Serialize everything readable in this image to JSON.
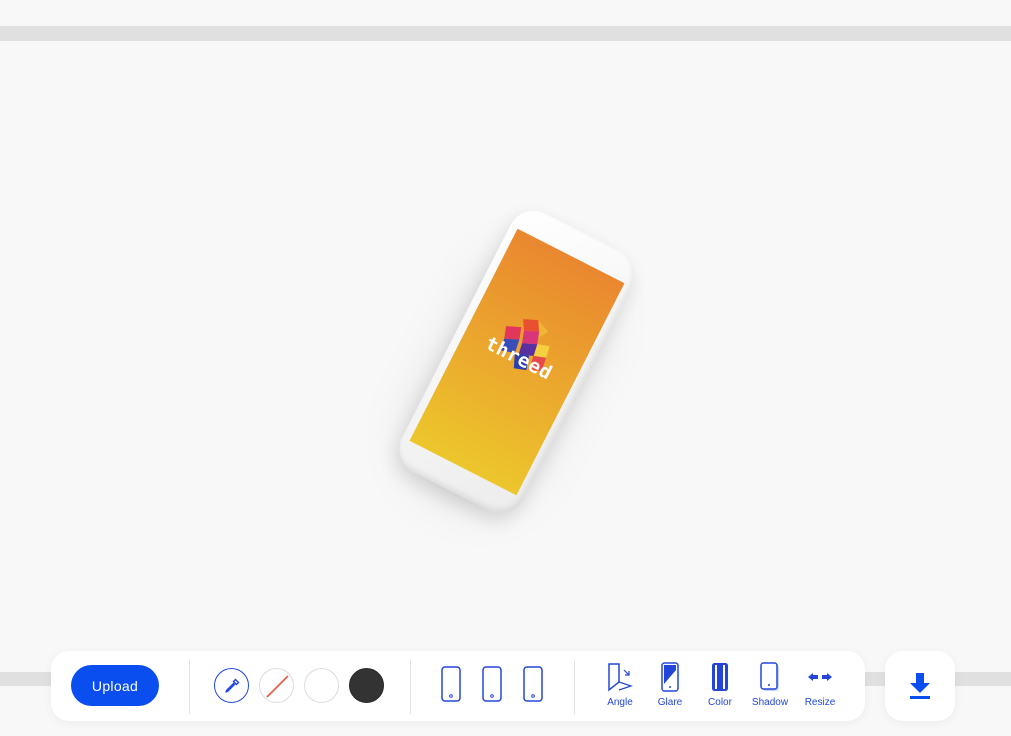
{
  "toolbar": {
    "upload_label": "Upload",
    "swatches": [
      "eyedropper-icon",
      "no-color",
      "#ffffff",
      "#333333"
    ],
    "devices": [
      "phone-portrait-icon",
      "phone-portrait-icon",
      "phone-portrait-icon"
    ],
    "tools": [
      {
        "label": "Angle",
        "icon": "angle-icon"
      },
      {
        "label": "Glare",
        "icon": "glare-icon"
      },
      {
        "label": "Color",
        "icon": "color-icon"
      },
      {
        "label": "Shadow",
        "icon": "shadow-icon"
      },
      {
        "label": "Resize",
        "icon": "resize-icon"
      }
    ]
  },
  "canvas": {
    "screen_word": "threed"
  },
  "download": {
    "icon": "download-icon"
  },
  "colors": {
    "accent": "#0a4ef0",
    "icon": "#2346d8",
    "screen_top": "#ea872f",
    "screen_bottom": "#ecc62c"
  }
}
